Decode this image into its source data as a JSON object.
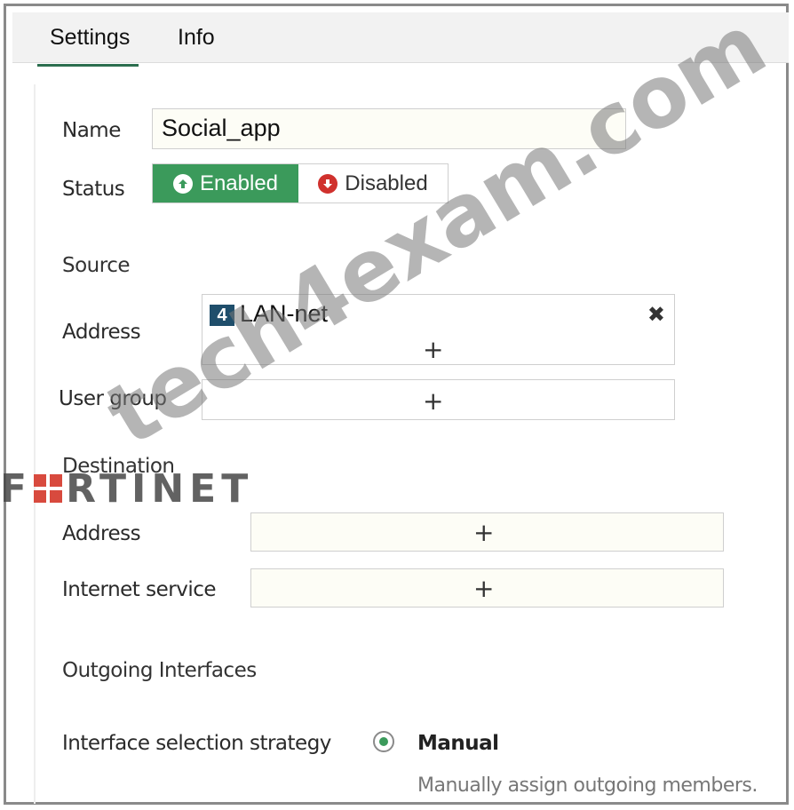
{
  "tabs": [
    {
      "label": "Settings",
      "active": true
    },
    {
      "label": "Info",
      "active": false
    }
  ],
  "form": {
    "name_label": "Name",
    "name_value": "Social_app",
    "status_label": "Status",
    "status_enabled": "Enabled",
    "status_disabled": "Disabled",
    "status_selected": "Enabled",
    "source_section": "Source",
    "source_address_label": "Address",
    "source_address_items": [
      {
        "badge": "4",
        "name": "LAN-net"
      }
    ],
    "user_group_label": "User group",
    "destination_section": "Destination",
    "dest_address_label": "Address",
    "internet_service_label": "Internet service",
    "add_symbol": "+",
    "remove_symbol": "✖",
    "outgoing_section": "Outgoing Interfaces",
    "strategy_label": "Interface selection strategy",
    "strategy_value": "Manual",
    "strategy_hint": "Manually assign outgoing members."
  },
  "overlay": {
    "watermark": "tech4exam.com",
    "logo_prefix": "F",
    "logo_suffix": "RTINET"
  },
  "colors": {
    "enabled_green": "#3b9a5b",
    "disabled_red": "#d0312d",
    "badge_blue": "#1f4e6b",
    "tab_underline": "#2c6e4f"
  },
  "icons": {
    "enabled": "arrow-up-circle-icon",
    "disabled": "arrow-down-circle-icon",
    "remove": "close-icon",
    "add": "plus-icon",
    "radio": "radio-selected-icon"
  }
}
